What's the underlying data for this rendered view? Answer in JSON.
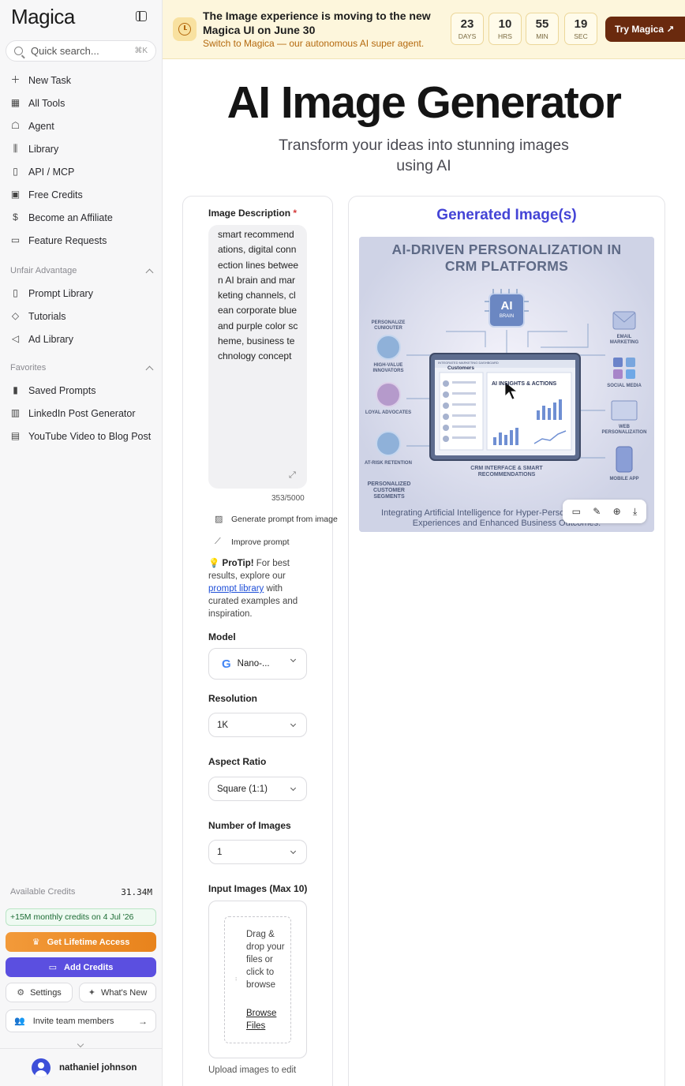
{
  "sidebar": {
    "logo": "Magica",
    "search_placeholder": "Quick search...",
    "search_shortcut": "⌘K",
    "main_nav": [
      {
        "label": "New Task",
        "icon": "plus-icon"
      },
      {
        "label": "All Tools",
        "icon": "grid-icon"
      },
      {
        "label": "Agent",
        "icon": "robot-icon"
      },
      {
        "label": "Library",
        "icon": "library-icon"
      },
      {
        "label": "API / MCP",
        "icon": "book-icon"
      },
      {
        "label": "Free Credits",
        "icon": "gift-icon"
      },
      {
        "label": "Become an Affiliate",
        "icon": "dollar-icon"
      },
      {
        "label": "Feature Requests",
        "icon": "feedback-icon"
      }
    ],
    "unfair_title": "Unfair Advantage",
    "unfair_items": [
      {
        "label": "Prompt Library",
        "icon": "book-open-icon"
      },
      {
        "label": "Tutorials",
        "icon": "graduation-icon"
      },
      {
        "label": "Ad Library",
        "icon": "megaphone-icon"
      }
    ],
    "favorites_title": "Favorites",
    "favorites_items": [
      {
        "label": "Saved Prompts",
        "icon": "bookmark-icon"
      },
      {
        "label": "LinkedIn Post Generator",
        "icon": "linkedin-icon"
      },
      {
        "label": "YouTube Video to Blog Post",
        "icon": "document-icon"
      }
    ],
    "credits_label": "Available Credits",
    "credits_value": "31.34M",
    "monthly_note": "+15M monthly credits on 4 Jul '26",
    "lifetime_label": "Get Lifetime Access",
    "add_credits_label": "Add Credits",
    "settings_label": "Settings",
    "whats_new_label": "What's New",
    "invite_label": "Invite team members",
    "user_name": "nathaniel johnson"
  },
  "banner": {
    "title": "The Image experience is moving to the new Magica UI on June 30",
    "subtitle": "Switch to Magica — our autonomous AI super agent.",
    "countdown": [
      {
        "value": "23",
        "unit": "DAYS"
      },
      {
        "value": "10",
        "unit": "HRS"
      },
      {
        "value": "55",
        "unit": "MIN"
      },
      {
        "value": "19",
        "unit": "SEC"
      }
    ],
    "cta": "Try Magica ↗"
  },
  "hero": {
    "title": "AI Image Generator",
    "subtitle": "Transform your ideas into stunning images using AI"
  },
  "form": {
    "description_label": "Image Description",
    "description_text": "smart recommendations, digital connection lines between AI brain and marketing channels, clean corporate blue and purple color scheme, business technology concept",
    "char_count": "353/5000",
    "gen_prompt_label": "Generate prompt from image",
    "improve_label": "Improve prompt",
    "protip_bold": "ProTip!",
    "protip_text1": "For best results, explore our",
    "protip_link": "prompt library",
    "protip_text2": "with curated examples and inspiration.",
    "model_label": "Model",
    "model_value": "Nano-...",
    "resolution_label": "Resolution",
    "resolution_value": "1K",
    "aspect_label": "Aspect Ratio",
    "aspect_value": "Square (1:1)",
    "number_label": "Number of Images",
    "number_value": "1",
    "input_images_label": "Input Images (Max 10)",
    "drop_text": "Drag & drop your files or click to browse",
    "browse_label": "Browse Files",
    "upload_note": "Upload images to edit"
  },
  "result": {
    "title": "Generated Image(s)",
    "image_title": "AI-DRIVEN PERSONALIZATION IN CRM PLATFORMS",
    "image_caption": "Integrating Artificial Intelligence for Hyper-Personalized Customer Experiences and Enhanced Business Outcomes.",
    "brain_label": "AI",
    "brain_sub": "BRAIN",
    "left_labels": [
      "PERSONALIZE CUNIOUTER",
      "HIGH-VALUE INNOVATORS",
      "LOYAL ADVOCATES",
      "AT-RISK RETENTION",
      "PERSONALIZED CUSTOMER SEGMENTS"
    ],
    "right_labels": [
      "EMAIL MARKETING",
      "SOCIAL MEDIA",
      "WEB PERSONALIZATION",
      "MOBILE APP"
    ],
    "screen_title": "Customers",
    "screen_panel": "AI INSIGHTS & ACTIONS",
    "screen_caption": "CRM INTERFACE & SMART RECOMMENDATIONS",
    "screen_header": "INTEGRATED MARKETING DASHBOARD",
    "colors": {
      "accent": "#4444d6",
      "brand_purple": "#5b4fe0",
      "banner_bg": "#fdf6dc",
      "cta_brown": "#6a2a0e"
    }
  }
}
